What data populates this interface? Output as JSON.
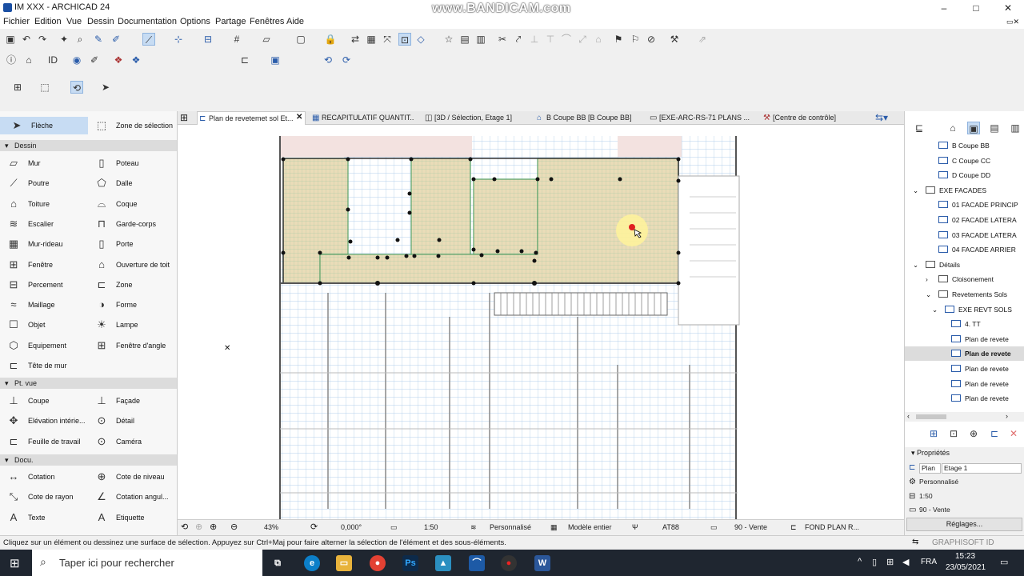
{
  "window": {
    "title": "IM XXX - ARCHICAD 24",
    "watermark": "www.BANDICAM.com",
    "minimize": "–",
    "maximize": "□",
    "close": "✕"
  },
  "menu": [
    "Fichier",
    "Edition",
    "Vue",
    "Dessin",
    "Documentation",
    "Options",
    "Partage",
    "Fenêtres",
    "Aide"
  ],
  "toolbox": {
    "arrow": "Flèche",
    "marquee": "Zone de sélection",
    "sections": {
      "dessin": "Dessin",
      "ptvue": "Pt. vue",
      "docu": "Docu."
    },
    "dessin_tools": [
      [
        "Mur",
        "Poteau"
      ],
      [
        "Poutre",
        "Dalle"
      ],
      [
        "Toiture",
        "Coque"
      ],
      [
        "Escalier",
        "Garde-corps"
      ],
      [
        "Mur-rideau",
        "Porte"
      ],
      [
        "Fenêtre",
        "Ouverture de toit"
      ],
      [
        "Percement",
        "Zone"
      ],
      [
        "Maillage",
        "Forme"
      ],
      [
        "Objet",
        "Lampe"
      ],
      [
        "Equipement",
        "Fenêtre d'angle"
      ],
      [
        "Tête de mur",
        ""
      ]
    ],
    "ptvue_tools": [
      [
        "Coupe",
        "Façade"
      ],
      [
        "Elévation intérie...",
        "Détail"
      ],
      [
        "Feuille de travail",
        "Caméra"
      ]
    ],
    "docu_tools": [
      [
        "Cotation",
        "Cote de niveau"
      ],
      [
        "Cote de rayon",
        "Cotation angul..."
      ],
      [
        "Texte",
        "Etiquette"
      ]
    ]
  },
  "tabs": [
    "Plan de revetemet sol Et...",
    "RECAPITULATIF QUANTIT...",
    "[3D / Sélection, Etage 1]",
    "B Coupe BB [B Coupe BB]",
    "[EXE-ARC-RS-71 PLANS ...",
    "[Centre de contrôle]"
  ],
  "tab_close": "✕",
  "navigator": {
    "items": [
      "B Coupe BB",
      "C Coupe CC",
      "D Coupe DD",
      "EXE FACADES",
      "01 FACADE PRINCIP",
      "02 FACADE LATERA",
      "03 FACADE LATERA",
      "04 FACADE ARRIER",
      "Détails",
      "Cloisonement",
      "Revetements Sols",
      "EXE REVT SOLS",
      "4. TT",
      "Plan de revete",
      "Plan de revete",
      "Plan de revete",
      "Plan de revete",
      "Plan de revete"
    ],
    "selected_index": 14
  },
  "properties": {
    "header": "Propriétés",
    "name_short": "Plan c",
    "story": "Etage 1",
    "mode": "Personnalisé",
    "scale": "1:50",
    "layer": "90 - Vente",
    "settings_button": "Réglages..."
  },
  "statusbar": {
    "zoom": "43%",
    "angle": "0,000°",
    "scale": "1:50",
    "mode": "Personnalisé",
    "model": "Modèle entier",
    "pen": "AT88",
    "layer": "90 - Vente",
    "view": "FOND PLAN R..."
  },
  "hint": "Cliquez sur un élément ou dessinez une surface de sélection. Appuyez sur Ctrl+Maj pour faire alterner la sélection de l'élément et des sous-éléments.",
  "graphisoft": "GRAPHISOFT ID",
  "taskbar": {
    "search_placeholder": "Taper ici pour rechercher",
    "lang": "FRA",
    "time": "15:23",
    "date": "23/05/2021"
  }
}
